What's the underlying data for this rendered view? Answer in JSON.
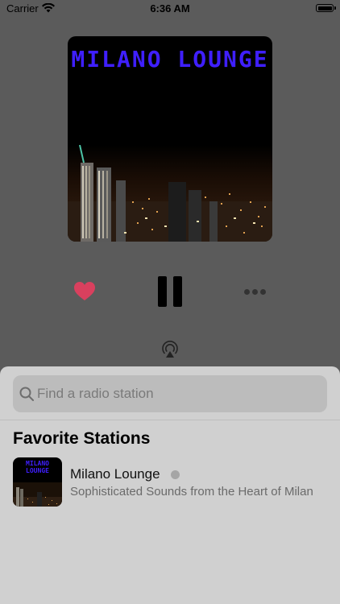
{
  "status_bar": {
    "carrier": "Carrier",
    "time": "6:36 AM"
  },
  "now_playing": {
    "artwork_title": "MILANO LOUNGE",
    "artwork_title_color": "#3f1fff",
    "favorite_icon": "heart-icon",
    "favorite_color": "#d9405e",
    "play_state_icon": "pause-icon",
    "more_icon": "ellipsis-icon",
    "airplay_icon": "airplay-icon"
  },
  "sheet": {
    "search": {
      "placeholder": "Find a radio station",
      "value": ""
    },
    "favorites_title": "Favorite Stations",
    "stations": [
      {
        "name": "Milano Lounge",
        "description": "Sophisticated Sounds from the Heart of Milan",
        "thumbnail_title": "MILANO LOUNGE"
      }
    ]
  }
}
